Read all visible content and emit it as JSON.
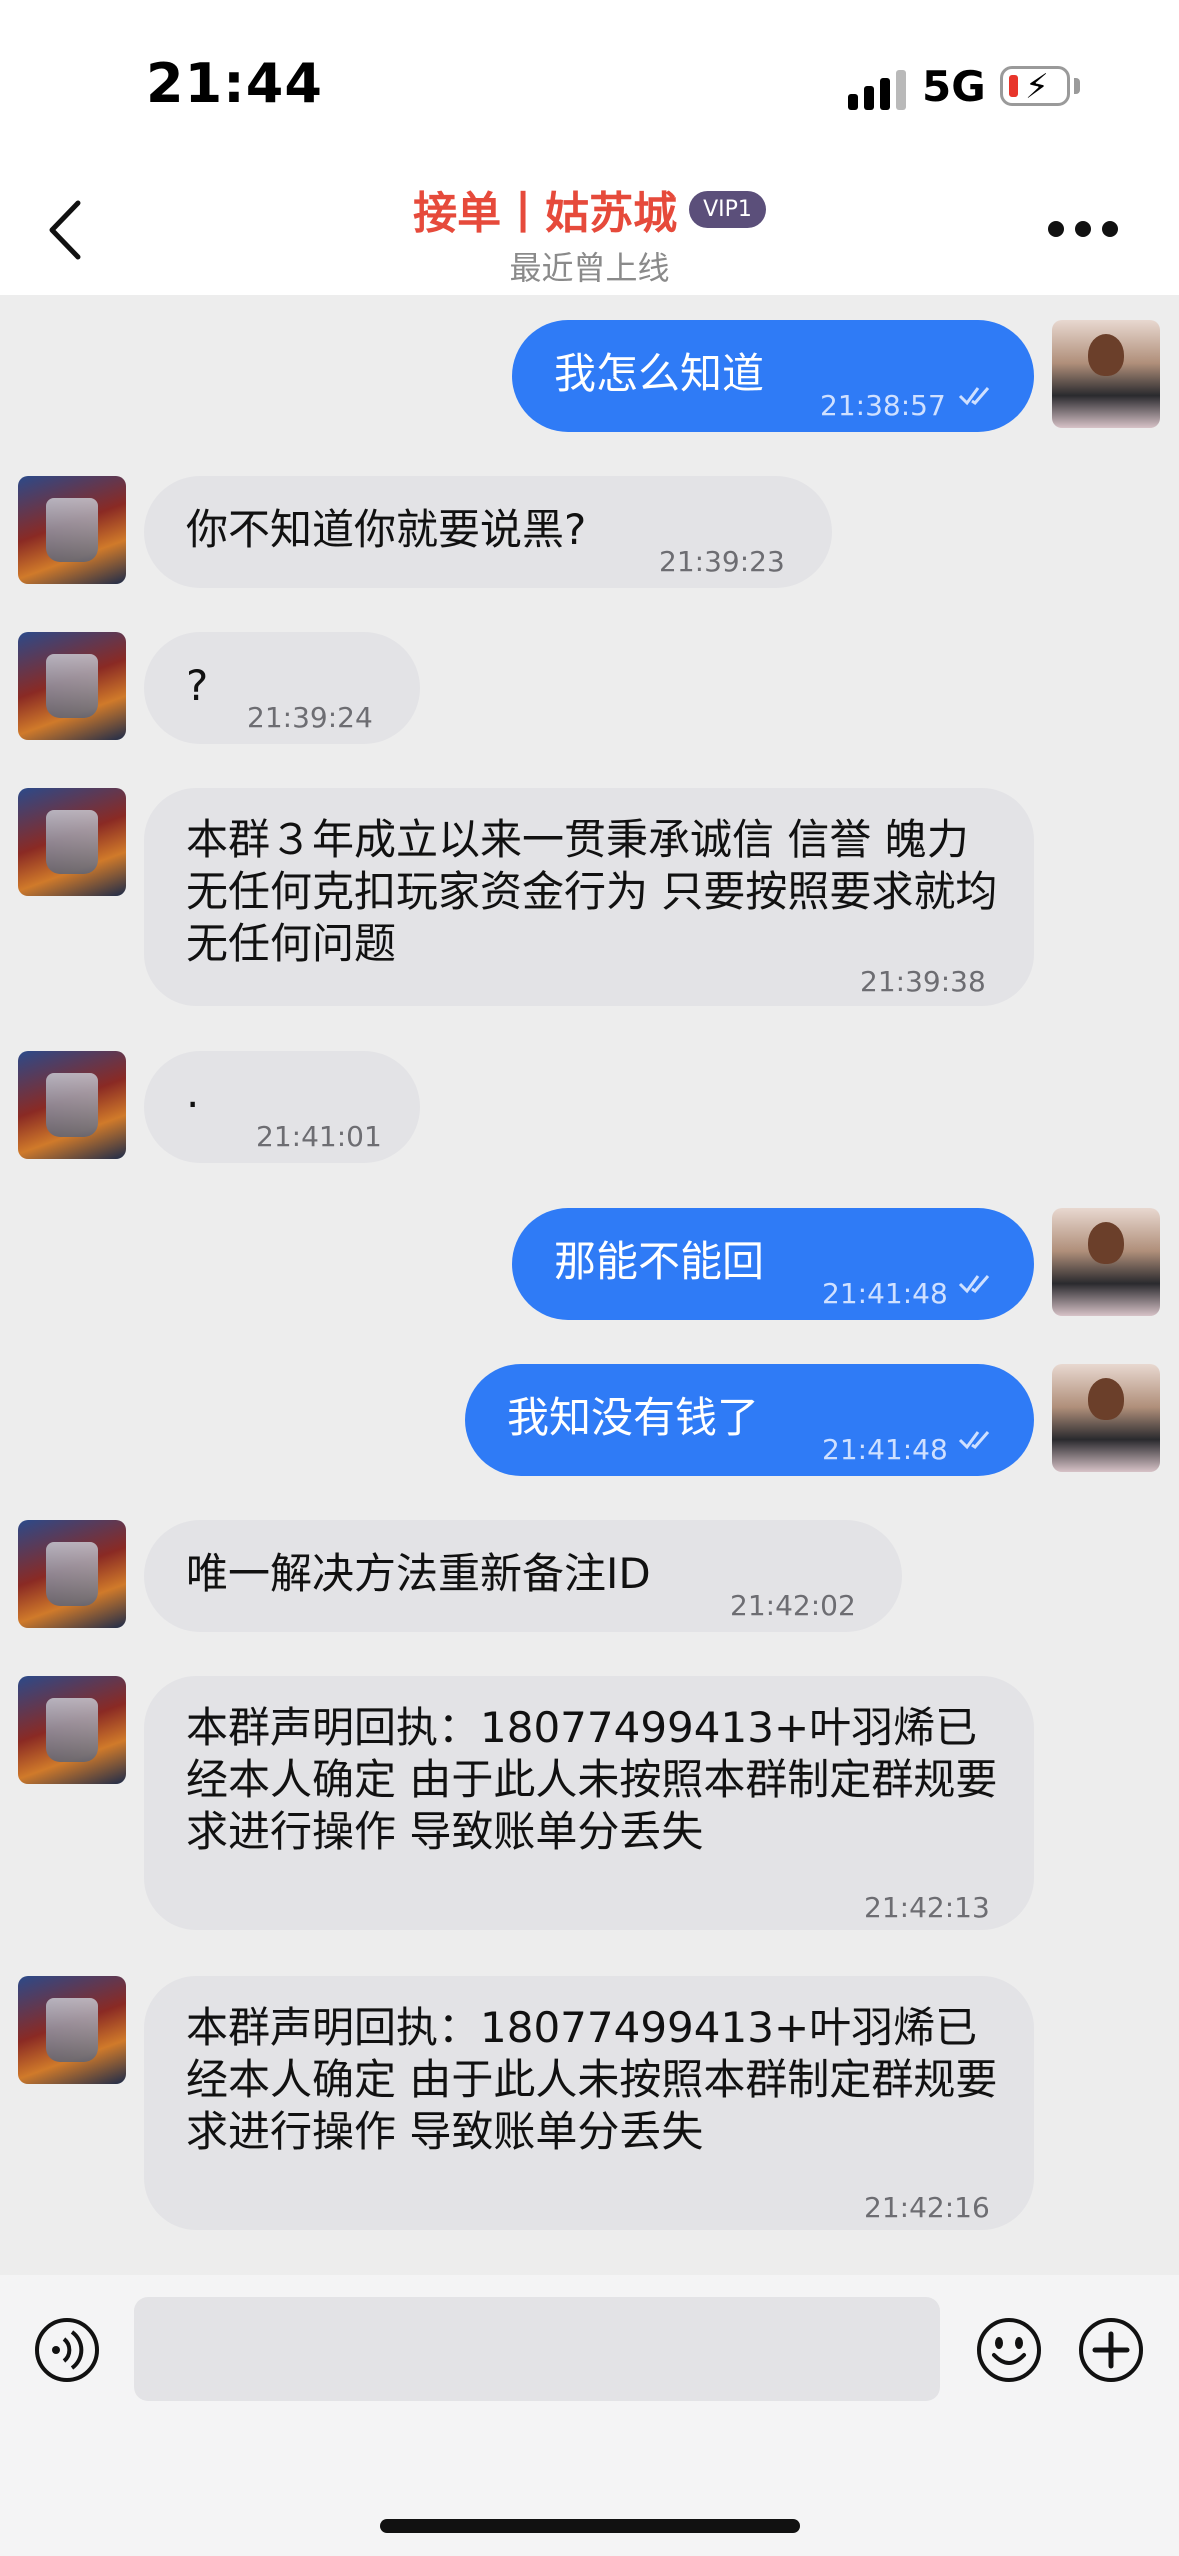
{
  "status_bar": {
    "time": "21:44",
    "network": "5G"
  },
  "header": {
    "title": "接单丨姑苏城",
    "badge": "VIP1",
    "subtitle": "最近曾上线"
  },
  "messages": [
    {
      "side": "out",
      "text": "我怎么知道",
      "time": "21:38:57",
      "read": true
    },
    {
      "side": "in",
      "text": "你不知道你就要说黑?",
      "time": "21:39:23"
    },
    {
      "side": "in",
      "text": "?",
      "time": "21:39:24"
    },
    {
      "side": "in",
      "text": "本群３年成立以来一贯秉承诚信 信誉 魄力 无任何克扣玩家资金行为 只要按照要求就均无任何问题",
      "time": "21:39:38"
    },
    {
      "side": "in",
      "text": "·",
      "time": "21:41:01"
    },
    {
      "side": "out",
      "text": "那能不能回",
      "time": "21:41:48",
      "read": true
    },
    {
      "side": "out",
      "text": "我知没有钱了",
      "time": "21:41:48",
      "read": true
    },
    {
      "side": "in",
      "text": "唯一解决方法重新备注ID",
      "time": "21:42:02"
    },
    {
      "side": "in",
      "text": "本群声明回执：18077499413+叶羽烯已经本人确定 由于此人未按照本群制定群规要求进行操作  导致账单分丢失",
      "time": "21:42:13"
    },
    {
      "side": "in",
      "text": "本群声明回执：18077499413+叶羽烯已经本人确定 由于此人未按照本群制定群规要求进行操作  导致账单分丢失",
      "time": "21:42:16"
    }
  ],
  "input": {
    "value": ""
  },
  "colors": {
    "outgoing": "#2f7bf6",
    "incoming": "#e3e3e6",
    "title": "#e64a3b"
  }
}
